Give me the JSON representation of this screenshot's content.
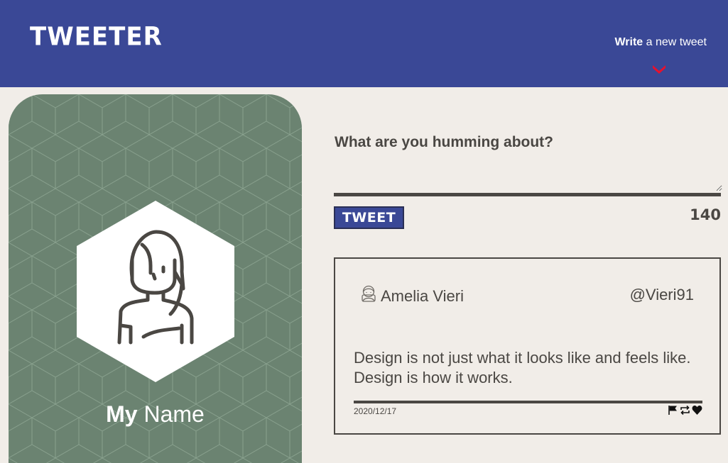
{
  "header": {
    "logo": "TWEETER",
    "write_bold": "Write",
    "write_rest": " a new tweet",
    "chevron_icon": "chevron-down-icon",
    "bg_color": "#3a4896",
    "accent_color": "#e8112d"
  },
  "profile": {
    "first_name": "My",
    "last_name": " Name",
    "card_color": "#6b8371",
    "avatar_icon": "person-avatar-icon"
  },
  "compose": {
    "label": "What are you humming about?",
    "value": "",
    "button_label": "TWEET",
    "char_count": "140"
  },
  "tweet": {
    "author": "Amelia Vieri",
    "handle": "@Vieri91",
    "body": "Design is not just what it looks like and feels like. Design is how it works.",
    "date": "2020/12/17",
    "actions": [
      "flag-icon",
      "retweet-icon",
      "heart-icon"
    ]
  }
}
